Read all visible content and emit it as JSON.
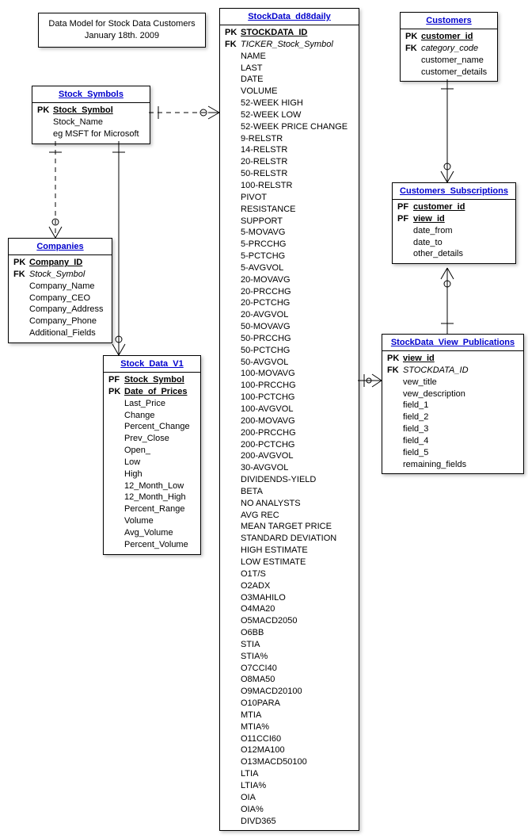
{
  "title": {
    "line1": "Data Model for Stock Data Customers",
    "line2": "January 18th. 2009"
  },
  "entities": {
    "stock_symbols": {
      "name": "Stock_Symbols",
      "attrs": [
        {
          "prefix": "PK",
          "cls": "pk",
          "name": "Stock_Symbol"
        },
        {
          "prefix": "",
          "cls": "",
          "name": "Stock_Name"
        },
        {
          "prefix": "",
          "cls": "",
          "name": "eg MSFT for Microsoft"
        }
      ]
    },
    "companies": {
      "name": "Companies",
      "attrs": [
        {
          "prefix": "PK",
          "cls": "pk",
          "name": "Company_ID"
        },
        {
          "prefix": "FK",
          "cls": "fk",
          "name": "Stock_Symbol"
        },
        {
          "prefix": "",
          "cls": "",
          "name": "Company_Name"
        },
        {
          "prefix": "",
          "cls": "",
          "name": "Company_CEO"
        },
        {
          "prefix": "",
          "cls": "",
          "name": "Company_Address"
        },
        {
          "prefix": "",
          "cls": "",
          "name": "Company_Phone"
        },
        {
          "prefix": "",
          "cls": "",
          "name": "Additional_Fields"
        }
      ]
    },
    "stock_data_v1": {
      "name": "Stock_Data_V1",
      "attrs": [
        {
          "prefix": "PF",
          "cls": "pf",
          "name": "Stock_Symbol"
        },
        {
          "prefix": "PK",
          "cls": "pk",
          "name": "Date_of_Prices"
        },
        {
          "prefix": "",
          "cls": "",
          "name": "Last_Price"
        },
        {
          "prefix": "",
          "cls": "",
          "name": "Change"
        },
        {
          "prefix": "",
          "cls": "",
          "name": "Percent_Change"
        },
        {
          "prefix": "",
          "cls": "",
          "name": "Prev_Close"
        },
        {
          "prefix": "",
          "cls": "",
          "name": "Open_"
        },
        {
          "prefix": "",
          "cls": "",
          "name": "Low"
        },
        {
          "prefix": "",
          "cls": "",
          "name": "High"
        },
        {
          "prefix": "",
          "cls": "",
          "name": "12_Month_Low"
        },
        {
          "prefix": "",
          "cls": "",
          "name": "12_Month_High"
        },
        {
          "prefix": "",
          "cls": "",
          "name": "Percent_Range"
        },
        {
          "prefix": "",
          "cls": "",
          "name": "Volume"
        },
        {
          "prefix": "",
          "cls": "",
          "name": "Avg_Volume"
        },
        {
          "prefix": "",
          "cls": "",
          "name": "Percent_Volume"
        }
      ]
    },
    "stockdata_dd8daily": {
      "name": "StockData_dd8daily",
      "attrs": [
        {
          "prefix": "PK",
          "cls": "pk",
          "name": "STOCKDATA_ID"
        },
        {
          "prefix": "FK",
          "cls": "fk",
          "name": "TICKER_Stock_Symbol"
        },
        {
          "prefix": "",
          "cls": "",
          "name": "NAME"
        },
        {
          "prefix": "",
          "cls": "",
          "name": "LAST"
        },
        {
          "prefix": "",
          "cls": "",
          "name": "DATE"
        },
        {
          "prefix": "",
          "cls": "",
          "name": "VOLUME"
        },
        {
          "prefix": "",
          "cls": "",
          "name": "52-WEEK HIGH"
        },
        {
          "prefix": "",
          "cls": "",
          "name": "52-WEEK LOW"
        },
        {
          "prefix": "",
          "cls": "",
          "name": "52-WEEK PRICE CHANGE"
        },
        {
          "prefix": "",
          "cls": "",
          "name": "9-RELSTR"
        },
        {
          "prefix": "",
          "cls": "",
          "name": "14-RELSTR"
        },
        {
          "prefix": "",
          "cls": "",
          "name": "20-RELSTR"
        },
        {
          "prefix": "",
          "cls": "",
          "name": "50-RELSTR"
        },
        {
          "prefix": "",
          "cls": "",
          "name": "100-RELSTR"
        },
        {
          "prefix": "",
          "cls": "",
          "name": "PIVOT"
        },
        {
          "prefix": "",
          "cls": "",
          "name": "RESISTANCE"
        },
        {
          "prefix": "",
          "cls": "",
          "name": "SUPPORT"
        },
        {
          "prefix": "",
          "cls": "",
          "name": "5-MOVAVG"
        },
        {
          "prefix": "",
          "cls": "",
          "name": "5-PRCCHG"
        },
        {
          "prefix": "",
          "cls": "",
          "name": "5-PCTCHG"
        },
        {
          "prefix": "",
          "cls": "",
          "name": "5-AVGVOL"
        },
        {
          "prefix": "",
          "cls": "",
          "name": "20-MOVAVG"
        },
        {
          "prefix": "",
          "cls": "",
          "name": "20-PRCCHG"
        },
        {
          "prefix": "",
          "cls": "",
          "name": "20-PCTCHG"
        },
        {
          "prefix": "",
          "cls": "",
          "name": "20-AVGVOL"
        },
        {
          "prefix": "",
          "cls": "",
          "name": "50-MOVAVG"
        },
        {
          "prefix": "",
          "cls": "",
          "name": "50-PRCCHG"
        },
        {
          "prefix": "",
          "cls": "",
          "name": "50-PCTCHG"
        },
        {
          "prefix": "",
          "cls": "",
          "name": "50-AVGVOL"
        },
        {
          "prefix": "",
          "cls": "",
          "name": "100-MOVAVG"
        },
        {
          "prefix": "",
          "cls": "",
          "name": "100-PRCCHG"
        },
        {
          "prefix": "",
          "cls": "",
          "name": "100-PCTCHG"
        },
        {
          "prefix": "",
          "cls": "",
          "name": "100-AVGVOL"
        },
        {
          "prefix": "",
          "cls": "",
          "name": "200-MOVAVG"
        },
        {
          "prefix": "",
          "cls": "",
          "name": "200-PRCCHG"
        },
        {
          "prefix": "",
          "cls": "",
          "name": "200-PCTCHG"
        },
        {
          "prefix": "",
          "cls": "",
          "name": "200-AVGVOL"
        },
        {
          "prefix": "",
          "cls": "",
          "name": "30-AVGVOL"
        },
        {
          "prefix": "",
          "cls": "",
          "name": "DIVIDENDS-YIELD"
        },
        {
          "prefix": "",
          "cls": "",
          "name": "BETA"
        },
        {
          "prefix": "",
          "cls": "",
          "name": "NO ANALYSTS"
        },
        {
          "prefix": "",
          "cls": "",
          "name": "AVG REC"
        },
        {
          "prefix": "",
          "cls": "",
          "name": "MEAN TARGET PRICE"
        },
        {
          "prefix": "",
          "cls": "",
          "name": "STANDARD DEVIATION"
        },
        {
          "prefix": "",
          "cls": "",
          "name": "HIGH ESTIMATE"
        },
        {
          "prefix": "",
          "cls": "",
          "name": "LOW ESTIMATE"
        },
        {
          "prefix": "",
          "cls": "",
          "name": "O1T/S"
        },
        {
          "prefix": "",
          "cls": "",
          "name": "O2ADX"
        },
        {
          "prefix": "",
          "cls": "",
          "name": "O3MAHILO"
        },
        {
          "prefix": "",
          "cls": "",
          "name": "O4MA20"
        },
        {
          "prefix": "",
          "cls": "",
          "name": "O5MACD2050"
        },
        {
          "prefix": "",
          "cls": "",
          "name": "O6BB"
        },
        {
          "prefix": "",
          "cls": "",
          "name": "STIA"
        },
        {
          "prefix": "",
          "cls": "",
          "name": "STIA%"
        },
        {
          "prefix": "",
          "cls": "",
          "name": "O7CCI40"
        },
        {
          "prefix": "",
          "cls": "",
          "name": "O8MA50"
        },
        {
          "prefix": "",
          "cls": "",
          "name": "O9MACD20100"
        },
        {
          "prefix": "",
          "cls": "",
          "name": "O10PARA"
        },
        {
          "prefix": "",
          "cls": "",
          "name": "MTIA"
        },
        {
          "prefix": "",
          "cls": "",
          "name": "MTIA%"
        },
        {
          "prefix": "",
          "cls": "",
          "name": "O11CCI60"
        },
        {
          "prefix": "",
          "cls": "",
          "name": "O12MA100"
        },
        {
          "prefix": "",
          "cls": "",
          "name": "O13MACD50100"
        },
        {
          "prefix": "",
          "cls": "",
          "name": "LTIA"
        },
        {
          "prefix": "",
          "cls": "",
          "name": "LTIA%"
        },
        {
          "prefix": "",
          "cls": "",
          "name": "OIA"
        },
        {
          "prefix": "",
          "cls": "",
          "name": "OIA%"
        },
        {
          "prefix": "",
          "cls": "",
          "name": "DIVD365"
        }
      ]
    },
    "customers": {
      "name": "Customers",
      "attrs": [
        {
          "prefix": "PK",
          "cls": "pk",
          "name": "customer_id"
        },
        {
          "prefix": "FK",
          "cls": "fk",
          "name": "category_code"
        },
        {
          "prefix": "",
          "cls": "",
          "name": "customer_name"
        },
        {
          "prefix": "",
          "cls": "",
          "name": "customer_details"
        }
      ]
    },
    "customers_subscriptions": {
      "name": "Customers_Subscriptions",
      "attrs": [
        {
          "prefix": "PF",
          "cls": "pf",
          "name": "customer_id"
        },
        {
          "prefix": "PF",
          "cls": "pf",
          "name": "view_id"
        },
        {
          "prefix": "",
          "cls": "",
          "name": "date_from"
        },
        {
          "prefix": "",
          "cls": "",
          "name": "date_to"
        },
        {
          "prefix": "",
          "cls": "",
          "name": "other_details"
        }
      ]
    },
    "stockdata_view_publications": {
      "name": "StockData_View_Publications",
      "attrs": [
        {
          "prefix": "PK",
          "cls": "pk",
          "name": "view_id"
        },
        {
          "prefix": "FK",
          "cls": "fk",
          "name": "STOCKDATA_ID"
        },
        {
          "prefix": "",
          "cls": "",
          "name": "vew_title"
        },
        {
          "prefix": "",
          "cls": "",
          "name": "vew_description"
        },
        {
          "prefix": "",
          "cls": "",
          "name": "field_1"
        },
        {
          "prefix": "",
          "cls": "",
          "name": "field_2"
        },
        {
          "prefix": "",
          "cls": "",
          "name": "field_3"
        },
        {
          "prefix": "",
          "cls": "",
          "name": "field_4"
        },
        {
          "prefix": "",
          "cls": "",
          "name": "field_5"
        },
        {
          "prefix": "",
          "cls": "",
          "name": "remaining_fields"
        }
      ]
    }
  }
}
